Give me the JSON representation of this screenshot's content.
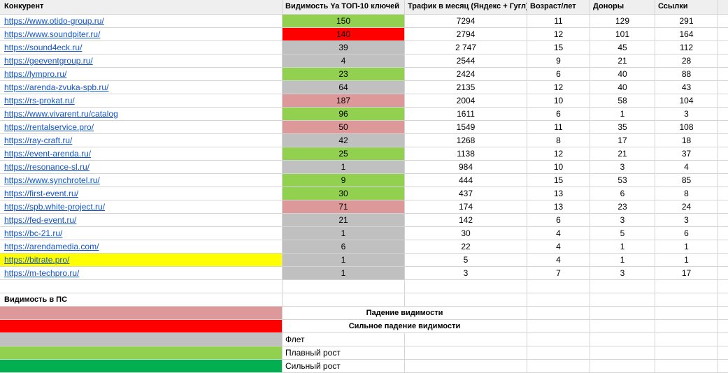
{
  "headers": [
    "Конкурент",
    "Видимость Ya ТОП-10 ключей",
    "Трафик в месяц (Яндекс + Гугл)",
    "Возраст/лет",
    "Доноры",
    "Ссылки"
  ],
  "colors": {
    "decline": "#dd9999",
    "strong_decline": "#ff0000",
    "flat": "#c0c0c0",
    "smooth_growth": "#92d050",
    "strong_growth": "#00b050",
    "highlight": "#ffff00",
    "link": "#1155cc",
    "header_bg": "#efefef"
  },
  "rows": [
    {
      "site": "https://www.otido-group.ru/",
      "visibility": "150",
      "vis_status": "smooth_growth",
      "traffic": "7294",
      "age": "11",
      "donors": "129",
      "links": "291"
    },
    {
      "site": "https://www.soundpiter.ru/",
      "visibility": "140",
      "vis_status": "strong_decline",
      "traffic": "2794",
      "age": "12",
      "donors": "101",
      "links": "164"
    },
    {
      "site": "https://sound4eck.ru/",
      "visibility": "39",
      "vis_status": "flat",
      "traffic": "2 747",
      "age": "15",
      "donors": "45",
      "links": "112"
    },
    {
      "site": "https://geeventgroup.ru/",
      "visibility": "4",
      "vis_status": "flat",
      "traffic": "2544",
      "age": "9",
      "donors": "21",
      "links": "28"
    },
    {
      "site": "https://lympro.ru/",
      "visibility": "23",
      "vis_status": "smooth_growth",
      "traffic": "2424",
      "age": "6",
      "donors": "40",
      "links": "88"
    },
    {
      "site": "https://arenda-zvuka-spb.ru/",
      "visibility": "64",
      "vis_status": "flat",
      "traffic": "2135",
      "age": "12",
      "donors": "40",
      "links": "43"
    },
    {
      "site": "https://rs-prokat.ru/",
      "visibility": "187",
      "vis_status": "decline",
      "traffic": "2004",
      "age": "10",
      "donors": "58",
      "links": "104"
    },
    {
      "site": "https://www.vivarent.ru/catalog",
      "visibility": "96",
      "vis_status": "smooth_growth",
      "traffic": "1611",
      "age": "6",
      "donors": "1",
      "links": "3"
    },
    {
      "site": "https://rentalservice.pro/",
      "visibility": "50",
      "vis_status": "decline",
      "traffic": "1549",
      "age": "11",
      "donors": "35",
      "links": "108"
    },
    {
      "site": "https://ray-craft.ru/",
      "visibility": "42",
      "vis_status": "flat",
      "traffic": "1268",
      "age": "8",
      "donors": "17",
      "links": "18"
    },
    {
      "site": "https://event-arenda.ru/",
      "visibility": "25",
      "vis_status": "smooth_growth",
      "traffic": "1138",
      "age": "12",
      "donors": "21",
      "links": "37"
    },
    {
      "site": "https://resonance-sl.ru/",
      "visibility": "1",
      "vis_status": "flat",
      "traffic": "984",
      "age": "10",
      "donors": "3",
      "links": "4"
    },
    {
      "site": "https://www.synchrotel.ru/",
      "visibility": "9",
      "vis_status": "smooth_growth",
      "traffic": "444",
      "age": "15",
      "donors": "53",
      "links": "85"
    },
    {
      "site": "https://first-event.ru/",
      "visibility": "30",
      "vis_status": "smooth_growth",
      "traffic": "437",
      "age": "13",
      "donors": "6",
      "links": "8"
    },
    {
      "site": "https://spb.white-project.ru/",
      "visibility": "71",
      "vis_status": "decline",
      "traffic": "174",
      "age": "13",
      "donors": "23",
      "links": "24"
    },
    {
      "site": "https://fed-event.ru/",
      "visibility": "21",
      "vis_status": "flat",
      "traffic": "142",
      "age": "6",
      "donors": "3",
      "links": "3"
    },
    {
      "site": "https://bc-21.ru/",
      "visibility": "1",
      "vis_status": "flat",
      "traffic": "30",
      "age": "4",
      "donors": "5",
      "links": "6"
    },
    {
      "site": "https://arendamedia.com/",
      "visibility": "6",
      "vis_status": "flat",
      "traffic": "22",
      "age": "4",
      "donors": "1",
      "links": "1"
    },
    {
      "site": "https://bitrate.pro/",
      "visibility": "1",
      "vis_status": "flat",
      "traffic": "5",
      "age": "4",
      "donors": "1",
      "links": "1",
      "highlight": true
    },
    {
      "site": "https://m-techpro.ru/",
      "visibility": "1",
      "vis_status": "flat",
      "traffic": "3",
      "age": "7",
      "donors": "3",
      "links": "17"
    }
  ],
  "legend": {
    "title": "Видимость в ПС",
    "items": [
      {
        "status": "decline",
        "label": "Падение видимости",
        "bold": true
      },
      {
        "status": "strong_decline",
        "label": "Сильное падение видимости",
        "bold": true
      },
      {
        "status": "flat",
        "label": "Флет",
        "bold": false
      },
      {
        "status": "smooth_growth",
        "label": "Плавный рост",
        "bold": false
      },
      {
        "status": "strong_growth",
        "label": "Сильный рост",
        "bold": false
      }
    ]
  }
}
